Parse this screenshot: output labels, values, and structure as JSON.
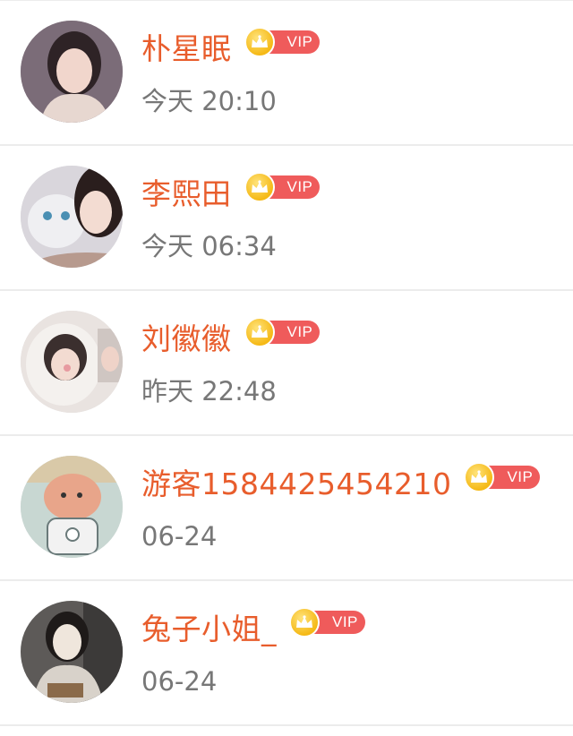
{
  "contacts": [
    {
      "name": "朴星眠",
      "time": "今天 20:10",
      "badge": "VIP",
      "avatar_bg": "#8a7a86",
      "avatar_fg": "#f1d6cc"
    },
    {
      "name": "李熙田",
      "time": "今天 06:34",
      "badge": "VIP",
      "avatar_bg": "#d9d6dc",
      "avatar_fg": "#3a2a28"
    },
    {
      "name": "刘徽徽",
      "time": "昨天 22:48",
      "badge": "VIP",
      "avatar_bg": "#e9e3e0",
      "avatar_fg": "#3b2f2e"
    },
    {
      "name": "游客1584425454210",
      "time": "06-24",
      "badge": "VIP",
      "avatar_bg": "#c8d7d2",
      "avatar_fg": "#e8a58a"
    },
    {
      "name": "兔子小姐_",
      "time": "06-24",
      "badge": "VIP",
      "avatar_bg": "#5d5a58",
      "avatar_fg": "#efe6dc"
    }
  ],
  "colors": {
    "name": "#e85d2c",
    "time": "#777777",
    "vip_pill": "#ef5b5b",
    "crown": "#f5b916",
    "divider": "#ececec"
  }
}
